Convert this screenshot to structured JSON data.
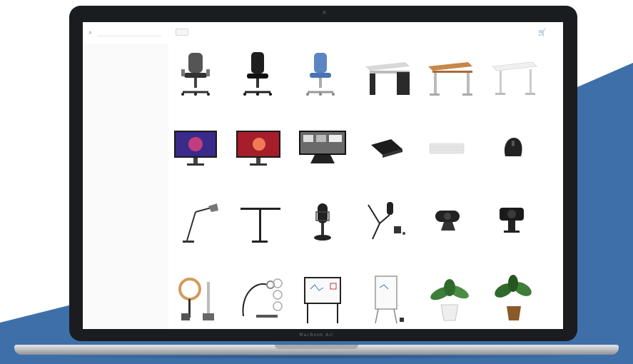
{
  "colors": {
    "background": "#ffffff",
    "accent_blue": "#3e6fa8",
    "laptop_frame": "#1b1c1f",
    "link_blue": "#3b6fb6"
  },
  "header": {
    "search_placeholder": "",
    "search_button_label": "",
    "login_label": "",
    "cart_icon": "cart-icon",
    "search_icon": "search-icon"
  },
  "sidebar": {
    "groups": [
      {
        "title": "",
        "items": []
      },
      {
        "title": "",
        "items": [
          "",
          ""
        ]
      },
      {
        "title": "",
        "items": [
          "",
          "",
          "",
          "",
          "",
          "",
          ""
        ]
      },
      {
        "title": "",
        "items": [
          "",
          "",
          ""
        ]
      },
      {
        "title": "",
        "items": [
          "",
          "",
          ""
        ]
      },
      {
        "title": "",
        "items": [
          "",
          "",
          "",
          ""
        ]
      }
    ]
  },
  "products": [
    {
      "icon": "office-chair-icon",
      "name": ""
    },
    {
      "icon": "office-chair-icon",
      "name": ""
    },
    {
      "icon": "office-chair-icon",
      "name": ""
    },
    {
      "icon": "desk-icon",
      "name": ""
    },
    {
      "icon": "desk-icon",
      "name": ""
    },
    {
      "icon": "desk-icon",
      "name": ""
    },
    {
      "icon": "monitor-icon",
      "name": ""
    },
    {
      "icon": "monitor-icon",
      "name": ""
    },
    {
      "icon": "monitor-icon",
      "name": ""
    },
    {
      "icon": "keyboard-icon",
      "name": ""
    },
    {
      "icon": "keyboard-icon",
      "name": ""
    },
    {
      "icon": "mouse-icon",
      "name": ""
    },
    {
      "icon": "desk-lamp-icon",
      "name": ""
    },
    {
      "icon": "desk-lamp-icon",
      "name": ""
    },
    {
      "icon": "microphone-icon",
      "name": ""
    },
    {
      "icon": "microphone-arm-icon",
      "name": ""
    },
    {
      "icon": "webcam-icon",
      "name": ""
    },
    {
      "icon": "webcam-icon",
      "name": ""
    },
    {
      "icon": "ring-light-icon",
      "name": ""
    },
    {
      "icon": "clamp-light-icon",
      "name": ""
    },
    {
      "icon": "whiteboard-icon",
      "name": ""
    },
    {
      "icon": "whiteboard-icon",
      "name": ""
    },
    {
      "icon": "plant-icon",
      "name": ""
    },
    {
      "icon": "plant-icon",
      "name": ""
    }
  ]
}
